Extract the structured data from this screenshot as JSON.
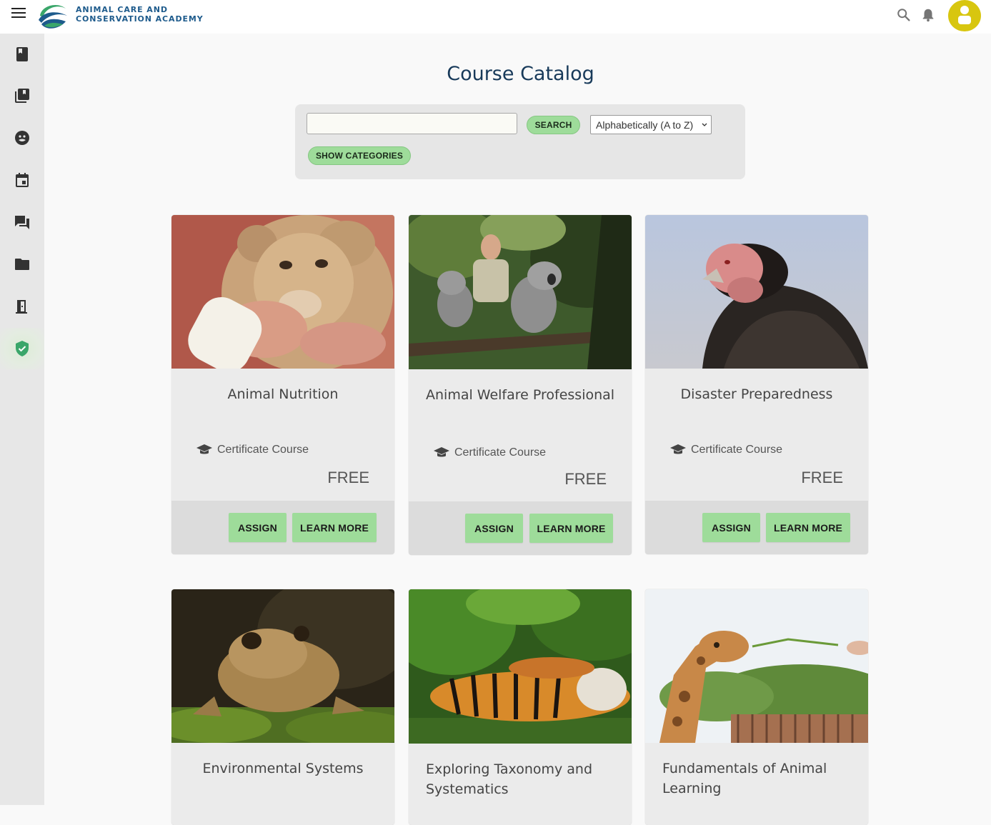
{
  "header": {
    "logo_line1": "ANIMAL CARE AND",
    "logo_line2": "CONSERVATION ACADEMY",
    "brand_colors": {
      "blue": "#1e5b8c",
      "green": "#3aa66a",
      "avatar": "#d8c60f"
    }
  },
  "sidebar": {
    "items": [
      {
        "icon": "book-icon"
      },
      {
        "icon": "library-icon"
      },
      {
        "icon": "face-icon"
      },
      {
        "icon": "calendar-icon"
      },
      {
        "icon": "forum-icon"
      },
      {
        "icon": "folder-icon"
      },
      {
        "icon": "exit-door-icon"
      },
      {
        "icon": "verified-shield-icon",
        "active": true
      }
    ]
  },
  "page": {
    "title": "Course Catalog"
  },
  "filters": {
    "search_value": "",
    "search_button": "SEARCH",
    "sort_selected": "Alphabetically (A to Z)",
    "show_categories_button": "SHOW CATEGORIES"
  },
  "courses": [
    {
      "title": "Animal Nutrition",
      "type": "Certificate Course",
      "price": "FREE",
      "assign": "ASSIGN",
      "learn_more": "LEARN MORE"
    },
    {
      "title": "Animal Welfare Professional",
      "type": "Certificate Course",
      "price": "FREE",
      "assign": "ASSIGN",
      "learn_more": "LEARN MORE"
    },
    {
      "title": "Disaster Preparedness",
      "type": "Certificate Course",
      "price": "FREE",
      "assign": "ASSIGN",
      "learn_more": "LEARN MORE"
    },
    {
      "title": "Environmental Systems"
    },
    {
      "title": "Exploring Taxonomy and Systematics"
    },
    {
      "title": "Fundamentals of Animal Learning"
    }
  ],
  "colors": {
    "accent_button": "#9edc9a",
    "title": "#183a5a"
  }
}
